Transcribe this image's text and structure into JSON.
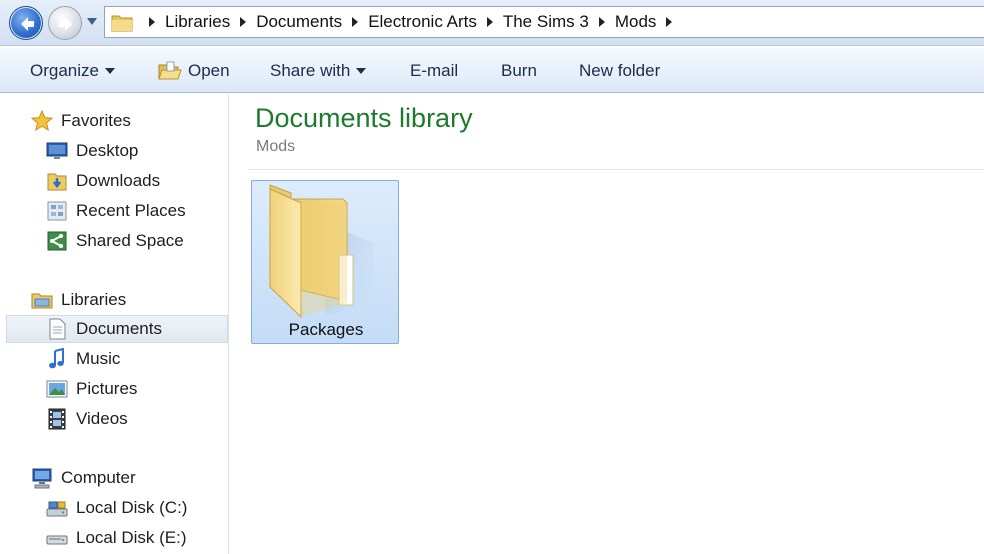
{
  "address_bar": {
    "breadcrumbs": [
      "Libraries",
      "Documents",
      "Electronic Arts",
      "The Sims 3",
      "Mods"
    ]
  },
  "toolbar": {
    "organize": "Organize",
    "open": "Open",
    "share_with": "Share with",
    "email": "E-mail",
    "burn": "Burn",
    "new_folder": "New folder"
  },
  "nav_pane": {
    "favorites": {
      "label": "Favorites",
      "items": [
        "Desktop",
        "Downloads",
        "Recent Places",
        "Shared Space"
      ]
    },
    "libraries": {
      "label": "Libraries",
      "items": [
        "Documents",
        "Music",
        "Pictures",
        "Videos"
      ],
      "selected": "Documents"
    },
    "computer": {
      "label": "Computer",
      "items": [
        "Local Disk (C:)",
        "Local Disk (E:)"
      ]
    }
  },
  "content": {
    "title": "Documents library",
    "subtitle": "Mods",
    "items": [
      {
        "name": "Packages",
        "type": "folder",
        "selected": true
      }
    ]
  },
  "colors": {
    "library_title": "#1e7a2c",
    "selection_fill": "#cfe3f9",
    "selection_border": "#84acdd",
    "folder_yellow": "#f2d57a"
  }
}
